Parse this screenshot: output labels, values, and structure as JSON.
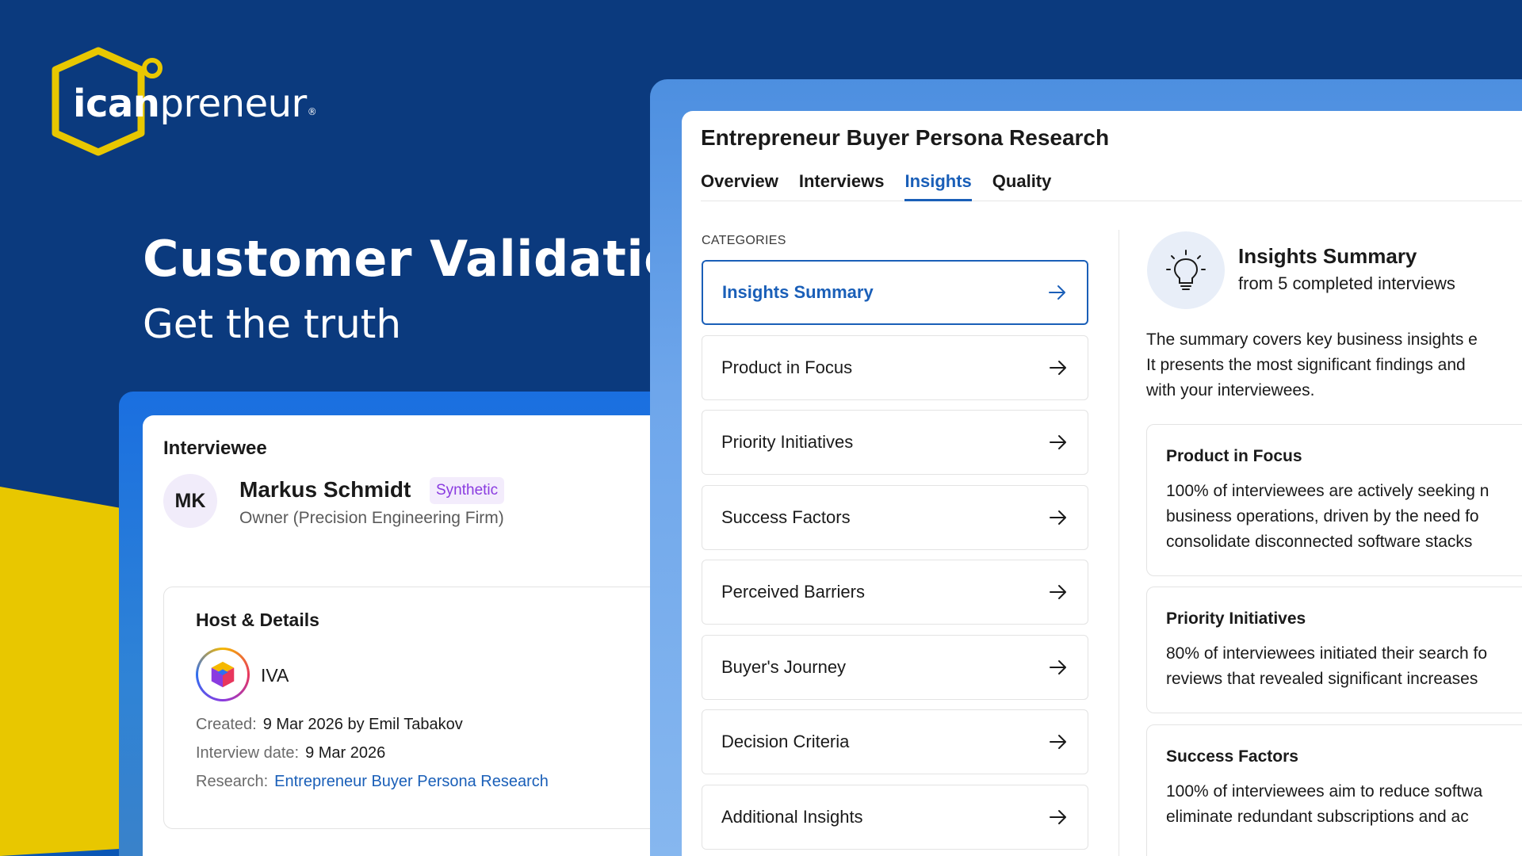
{
  "brand": {
    "logo_bold": "ican",
    "logo_regular": "preneur",
    "logo_mark": "®",
    "colors": {
      "navy": "#0b3a7e",
      "yellow": "#e8c700",
      "accent_blue": "#1a5fb8",
      "synthetic_purple": "#8a3be0"
    }
  },
  "hero": {
    "title": "Customer Validation",
    "subtitle": "Get the truth"
  },
  "interviewee_card": {
    "heading": "Interviewee",
    "avatar_initials": "MK",
    "name": "Markus Schmidt",
    "badge": "Synthetic",
    "role": "Owner (Precision Engineering Firm)",
    "details": {
      "heading": "Host & Details",
      "host_icon": "iva-cube-icon",
      "host_name": "IVA",
      "created_label": "Created:",
      "created_value": "9 Mar 2026 by Emil Tabakov",
      "interview_date_label": "Interview date:",
      "interview_date_value": "9 Mar 2026",
      "research_label": "Research:",
      "research_value": "Entrepreneur Buyer Persona Research"
    }
  },
  "research_card": {
    "title": "Entrepreneur Buyer Persona Research",
    "tabs": [
      {
        "label": "Overview"
      },
      {
        "label": "Interviews"
      },
      {
        "label": "Insights"
      },
      {
        "label": "Quality"
      }
    ],
    "active_tab": "Insights",
    "categories_label": "CATEGORIES",
    "categories": [
      {
        "label": "Insights Summary"
      },
      {
        "label": "Product in Focus"
      },
      {
        "label": "Priority Initiatives"
      },
      {
        "label": "Success Factors"
      },
      {
        "label": "Perceived Barriers"
      },
      {
        "label": "Buyer's Journey"
      },
      {
        "label": "Decision Criteria"
      },
      {
        "label": "Additional Insights"
      }
    ],
    "summary": {
      "icon": "lightbulb-icon",
      "title": "Insights Summary",
      "subtitle": "from 5 completed interviews",
      "desc_lines": [
        "The summary covers key business insights e",
        "It presents the most significant findings and",
        "with your interviewees."
      ],
      "sections": [
        {
          "heading": "Product in Focus",
          "lines": [
            "100% of interviewees are actively seeking n",
            "business operations, driven by the need fo",
            "consolidate disconnected software stacks"
          ]
        },
        {
          "heading": "Priority Initiatives",
          "lines": [
            "80% of interviewees initiated their search fo",
            "reviews that revealed significant increases"
          ]
        },
        {
          "heading": "Success Factors",
          "lines": [
            "100% of interviewees aim to reduce softwa",
            "eliminate redundant subscriptions and ac"
          ]
        }
      ]
    }
  }
}
